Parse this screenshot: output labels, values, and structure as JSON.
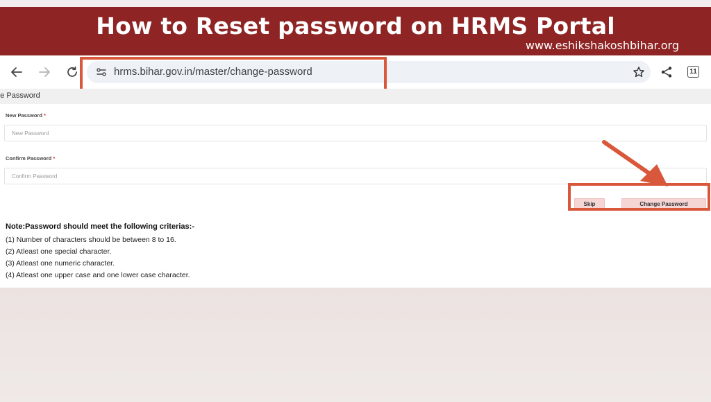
{
  "banner": {
    "title": "How to Reset password on HRMS Portal",
    "site": "www.eshikshakoshbihar.org",
    "color": "#8e2424"
  },
  "browser": {
    "url": "hrms.bihar.gov.in/master/change-password",
    "tabs_count": "11",
    "icons": [
      "back-arrow-icon",
      "forward-arrow-icon",
      "reload-icon",
      "site-settings-icon",
      "star-icon",
      "share-icon",
      "tabs-icon"
    ]
  },
  "page": {
    "title": "nge Password"
  },
  "form": {
    "new_password": {
      "label": "New Password",
      "required": "*",
      "placeholder": "New Password"
    },
    "confirm_password": {
      "label": "Confirm Password",
      "required": "*",
      "placeholder": "Confirm Password"
    },
    "skip_label": "Skip",
    "change_label": "Change Password"
  },
  "note": {
    "heading": "Note:Password should meet the following criterias:-",
    "items": [
      "(1) Number of characters should be between 8 to 16.",
      "(2) Atleast one special character.",
      "(3) Atleast one numeric character.",
      "(4) Atleast one upper case and one lower case character."
    ]
  },
  "annotation_color": "#d9573a"
}
